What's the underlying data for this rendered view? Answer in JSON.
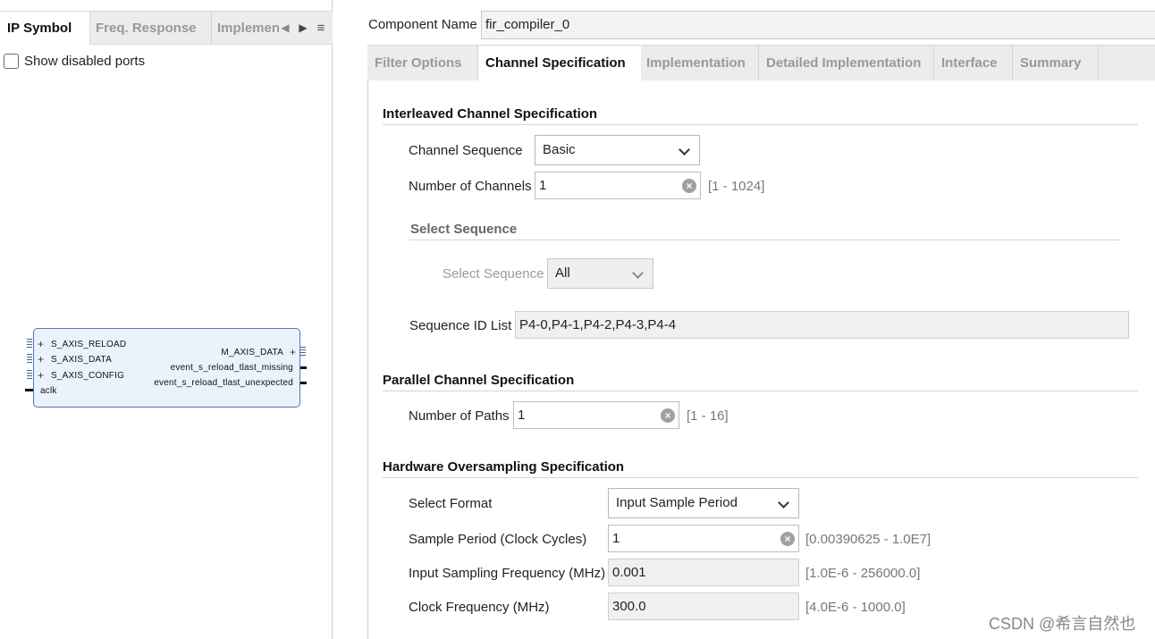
{
  "left_panel": {
    "tabs": [
      "IP Symbol",
      "Freq. Response",
      "Implemen"
    ],
    "show_disabled_ports_label": "Show disabled ports",
    "ip_symbol": {
      "input_ports": [
        "S_AXIS_RELOAD",
        "S_AXIS_DATA",
        "S_AXIS_CONFIG",
        "aclk"
      ],
      "output_ports": [
        "M_AXIS_DATA",
        "event_s_reload_tlast_missing",
        "event_s_reload_tlast_unexpected"
      ]
    }
  },
  "component_name": {
    "label": "Component Name",
    "value": "fir_compiler_0"
  },
  "tabs": [
    "Filter Options",
    "Channel Specification",
    "Implementation",
    "Detailed Implementation",
    "Interface",
    "Summary"
  ],
  "active_tab": "Channel Specification",
  "interleaved": {
    "title": "Interleaved Channel Specification",
    "channel_sequence_label": "Channel Sequence",
    "channel_sequence_value": "Basic",
    "num_channels_label": "Number of Channels",
    "num_channels_value": "1",
    "num_channels_range": "[1 - 1024]",
    "select_sequence_group": "Select Sequence",
    "select_sequence_label": "Select Sequence",
    "select_sequence_value": "All",
    "sequence_id_label": "Sequence ID List",
    "sequence_id_value": "P4-0,P4-1,P4-2,P4-3,P4-4"
  },
  "parallel": {
    "title": "Parallel Channel Specification",
    "num_paths_label": "Number of Paths",
    "num_paths_value": "1",
    "num_paths_range": "[1 - 16]"
  },
  "oversampling": {
    "title": "Hardware Oversampling Specification",
    "format_label": "Select Format",
    "format_value": "Input Sample Period",
    "sample_period_label": "Sample Period (Clock Cycles)",
    "sample_period_value": "1",
    "sample_period_range": "[0.00390625 - 1.0E7]",
    "input_freq_label": "Input Sampling Frequency (MHz)",
    "input_freq_value": "0.001",
    "input_freq_range": "[1.0E-6 - 256000.0]",
    "clock_freq_label": "Clock Frequency (MHz)",
    "clock_freq_value": "300.0",
    "clock_freq_range": "[4.0E-6 - 1000.0]"
  },
  "watermark": "CSDN @希言自然也"
}
